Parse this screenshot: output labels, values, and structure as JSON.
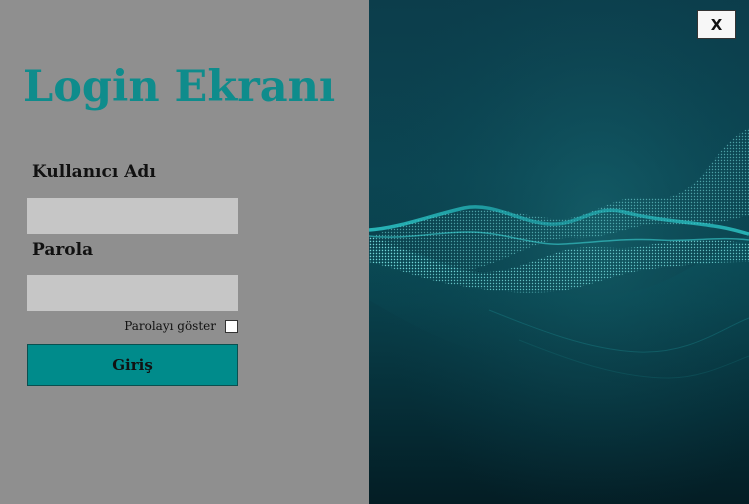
{
  "login_form": {
    "title": "Login Ekranı",
    "username_label": "Kullanıcı Adı",
    "username_value": "",
    "password_label": "Parola",
    "password_value": "",
    "show_password_label": "Parolayı göster",
    "show_password_checked": false,
    "submit_label": "Giriş"
  },
  "window": {
    "close_label": "X"
  },
  "colors": {
    "left_panel_bg": "#8f8f8f",
    "title_color": "#0f8c8c",
    "input_bg": "#c6c6c6",
    "button_bg": "#008b8b",
    "right_panel_bg": "#0b4552"
  },
  "icons": {
    "background_art": "teal-particle-wave-image"
  }
}
